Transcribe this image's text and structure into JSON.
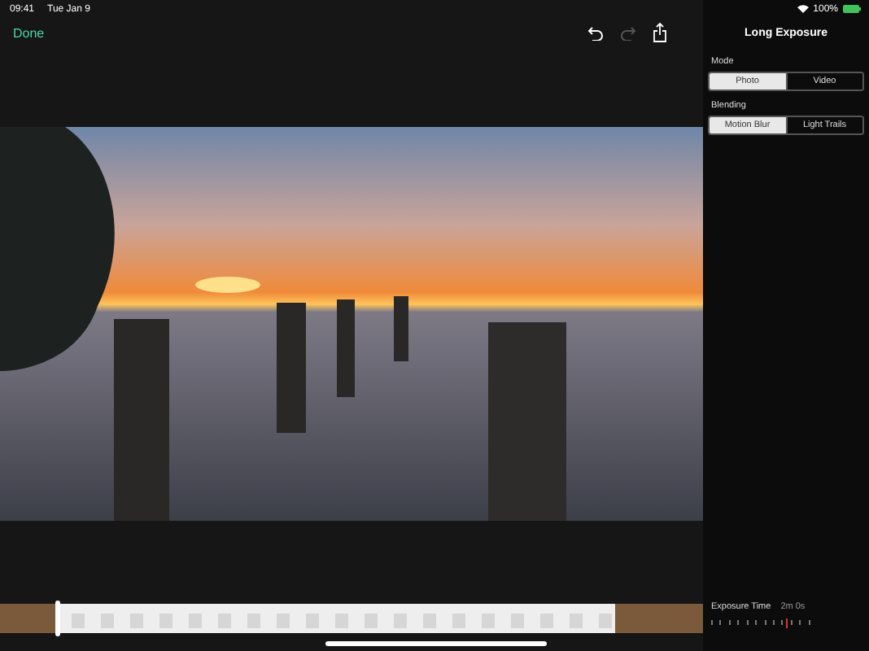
{
  "status_bar": {
    "time": "09:41",
    "date": "Tue Jan 9",
    "battery": "100%"
  },
  "nav_bar": {
    "done": "Done",
    "title": "Long Exposure"
  },
  "panel": {
    "sections": [
      {
        "label": "Mode",
        "options": [
          {
            "label": "Photo",
            "selected": true
          },
          {
            "label": "Video",
            "selected": false
          }
        ]
      },
      {
        "label": "Blending",
        "options": [
          {
            "label": "Motion Blur",
            "selected": true
          },
          {
            "label": "Light Trails",
            "selected": false
          }
        ]
      }
    ],
    "exposure": {
      "label": "Exposure Time",
      "value": "2m 0s",
      "level": 0.8
    }
  }
}
